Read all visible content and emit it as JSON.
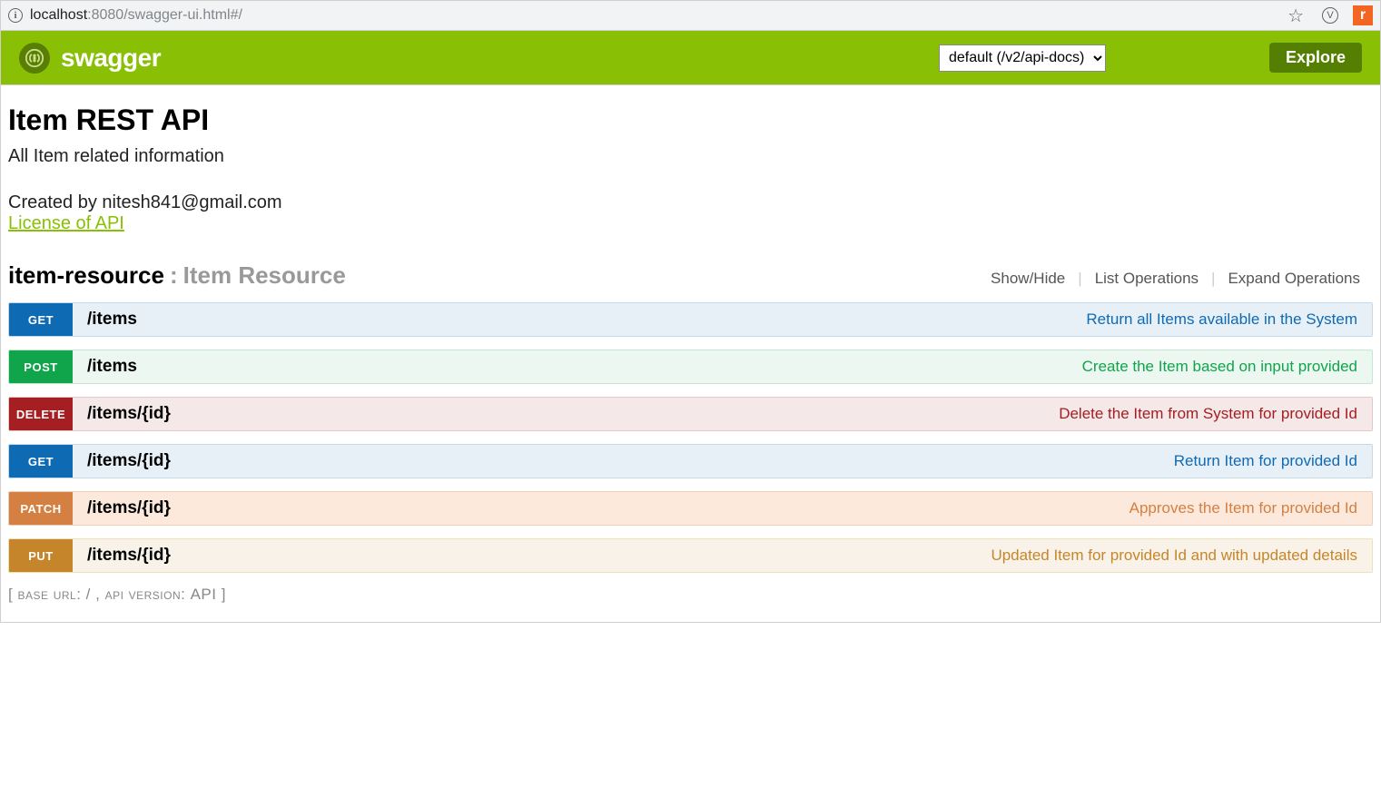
{
  "browser": {
    "url_host": "localhost",
    "url_port_path": ":8080/swagger-ui.html#/",
    "ext_v_label": "V",
    "ext_orange_label": "r"
  },
  "header": {
    "brand": "swagger",
    "api_select_value": "default (/v2/api-docs)",
    "explore_label": "Explore"
  },
  "info": {
    "title": "Item REST API",
    "description": "All Item related information",
    "created_by": "Created by nitesh841@gmail.com",
    "license_label": "License of API"
  },
  "resource": {
    "name": "item-resource",
    "label": "Item Resource",
    "actions": {
      "show_hide": "Show/Hide",
      "list_ops": "List Operations",
      "expand_ops": "Expand Operations"
    }
  },
  "operations": [
    {
      "method": "GET",
      "path": "/items",
      "summary": "Return all Items available in the System",
      "variant": "get"
    },
    {
      "method": "POST",
      "path": "/items",
      "summary": "Create the Item based on input provided",
      "variant": "post"
    },
    {
      "method": "DELETE",
      "path": "/items/{id}",
      "summary": "Delete the Item from System for provided Id",
      "variant": "delete"
    },
    {
      "method": "GET",
      "path": "/items/{id}",
      "summary": "Return Item for provided Id",
      "variant": "get"
    },
    {
      "method": "PATCH",
      "path": "/items/{id}",
      "summary": "Approves the Item for provided Id",
      "variant": "patch"
    },
    {
      "method": "PUT",
      "path": "/items/{id}",
      "summary": "Updated Item for provided Id and with updated details",
      "variant": "put"
    }
  ],
  "footer": {
    "base_url_label": "base url",
    "base_url_value": "/",
    "api_version_label": "api version",
    "api_version_value": "API"
  }
}
